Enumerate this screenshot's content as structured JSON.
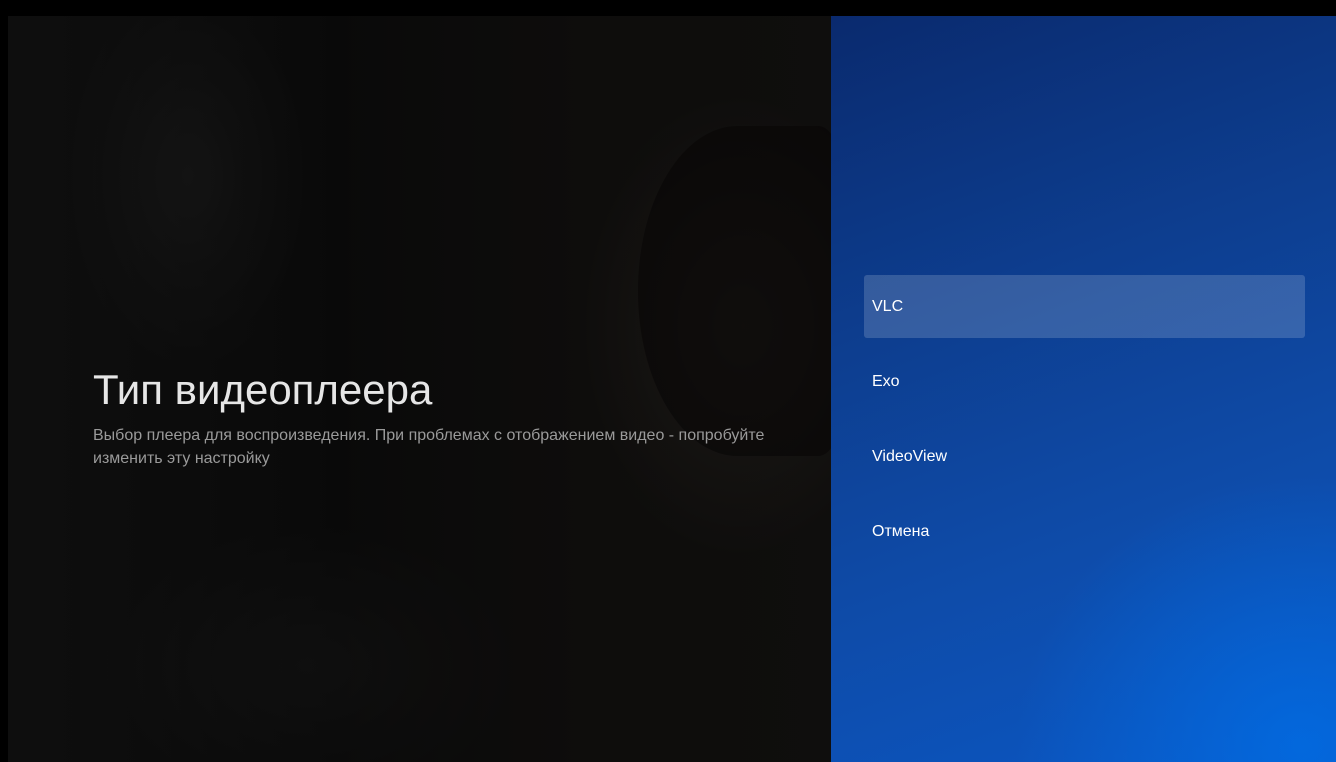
{
  "guidance": {
    "title": "Тип видеоплеера",
    "description": "Выбор плеера для воспроизведения. При проблемах с отображением видео - попробуйте изменить эту настройку"
  },
  "actions": [
    {
      "label": "VLC",
      "focused": true
    },
    {
      "label": "Exo",
      "focused": false
    },
    {
      "label": "VideoView",
      "focused": false
    },
    {
      "label": "Отмена",
      "focused": false
    }
  ],
  "colors": {
    "panel_blue": "#0d47a1",
    "focus_highlight": "#ffffff2b",
    "title_text": "#e6e6e6",
    "description_text": "#9a9a9a"
  }
}
